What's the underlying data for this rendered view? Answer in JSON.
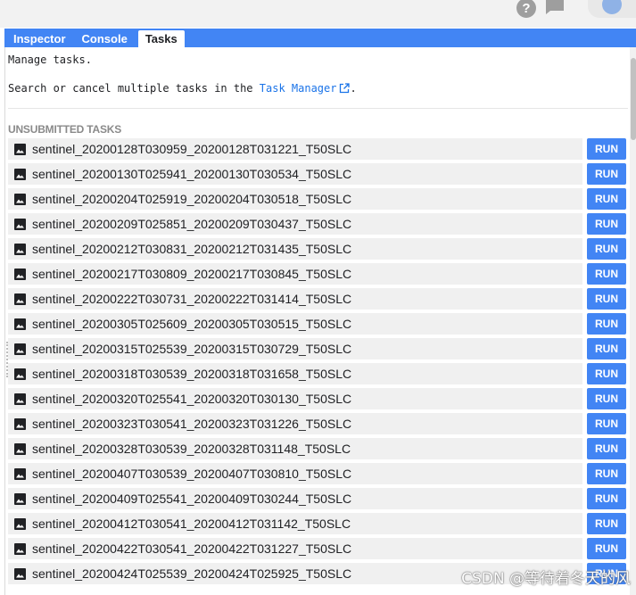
{
  "tabs": [
    {
      "label": "Inspector"
    },
    {
      "label": "Console"
    },
    {
      "label": "Tasks"
    }
  ],
  "tasks_panel": {
    "intro": "Manage tasks.",
    "search_prefix": "Search or cancel multiple tasks in the ",
    "task_manager_link": "Task Manager",
    "search_suffix": ".",
    "section_title": "UNSUBMITTED TASKS",
    "run_label": "RUN",
    "tasks": [
      {
        "name": "sentinel_20200128T030959_20200128T031221_T50SLC"
      },
      {
        "name": "sentinel_20200130T025941_20200130T030534_T50SLC"
      },
      {
        "name": "sentinel_20200204T025919_20200204T030518_T50SLC"
      },
      {
        "name": "sentinel_20200209T025851_20200209T030437_T50SLC"
      },
      {
        "name": "sentinel_20200212T030831_20200212T031435_T50SLC"
      },
      {
        "name": "sentinel_20200217T030809_20200217T030845_T50SLC"
      },
      {
        "name": "sentinel_20200222T030731_20200222T031414_T50SLC"
      },
      {
        "name": "sentinel_20200305T025609_20200305T030515_T50SLC"
      },
      {
        "name": "sentinel_20200315T025539_20200315T030729_T50SLC"
      },
      {
        "name": "sentinel_20200318T030539_20200318T031658_T50SLC"
      },
      {
        "name": "sentinel_20200320T025541_20200320T030130_T50SLC"
      },
      {
        "name": "sentinel_20200323T030541_20200323T031226_T50SLC"
      },
      {
        "name": "sentinel_20200328T030539_20200328T031148_T50SLC"
      },
      {
        "name": "sentinel_20200407T030539_20200407T030810_T50SLC"
      },
      {
        "name": "sentinel_20200409T025541_20200409T030244_T50SLC"
      },
      {
        "name": "sentinel_20200412T030541_20200412T031142_T50SLC"
      },
      {
        "name": "sentinel_20200422T030541_20200422T031227_T50SLC"
      },
      {
        "name": "sentinel_20200424T025539_20200424T025925_T50SLC"
      }
    ]
  },
  "watermark": "CSDN @等待着冬天的风",
  "colors": {
    "accent": "#4285f4",
    "link": "#1a73e8",
    "row_bg": "#f0f0f0"
  },
  "icons": {
    "help": "help-icon",
    "feedback": "feedback-icon",
    "account": "avatar",
    "task": "image-icon",
    "external": "open-in-new-icon"
  }
}
